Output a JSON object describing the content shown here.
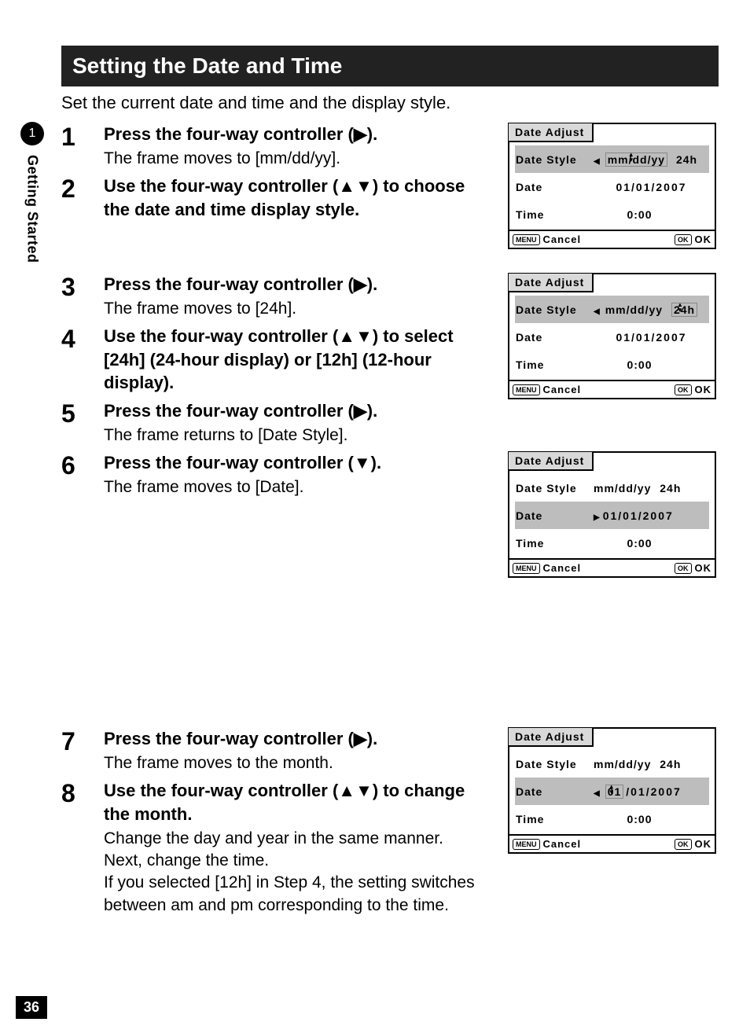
{
  "page_number": "36",
  "side_tab": {
    "chapter": "1",
    "label": "Getting Started"
  },
  "section_title": "Setting the Date and Time",
  "intro": "Set the current date and time and the display style.",
  "glyphs": {
    "right": "▶",
    "up": "▲",
    "down": "▼"
  },
  "steps": {
    "s1": {
      "num": "1",
      "instr_a": "Press the four-way controller (",
      "instr_b": ").",
      "desc": "The frame moves to [mm/dd/yy]."
    },
    "s2": {
      "num": "2",
      "instr_a": "Use the four-way controller (",
      "instr_b": ") to choose the date and time display style."
    },
    "s3": {
      "num": "3",
      "instr_a": "Press the four-way controller (",
      "instr_b": ").",
      "desc": "The frame moves to [24h]."
    },
    "s4": {
      "num": "4",
      "instr_a": "Use the four-way controller (",
      "instr_b": ") to select [24h] (24-hour display) or [12h] (12-hour display)."
    },
    "s5": {
      "num": "5",
      "instr_a": "Press the four-way controller (",
      "instr_b": ").",
      "desc": "The frame returns to [Date Style]."
    },
    "s6": {
      "num": "6",
      "instr_a": "Press the four-way controller (",
      "instr_b": ").",
      "desc": "The frame moves to [Date]."
    },
    "s7": {
      "num": "7",
      "instr_a": "Press the four-way controller (",
      "instr_b": ").",
      "desc": "The frame moves to the month."
    },
    "s8": {
      "num": "8",
      "instr_a": "Use the four-way controller (",
      "instr_b": ") to change the month.",
      "desc": "Change the day and year in the same manner.\nNext, change the time.\nIf you selected [12h] in Step 4, the setting switches between am and pm corresponding to the time."
    }
  },
  "lcd": {
    "title": "Date Adjust",
    "labels": {
      "style": "Date Style",
      "date": "Date",
      "time": "Time"
    },
    "values": {
      "style_fmt": "mm/dd/yy",
      "style_hr": "24h",
      "date": "01/01/2007",
      "month": "01",
      "rest": "/01/2007",
      "time": "0:00"
    },
    "footer": {
      "menu_btn": "MENU",
      "cancel": "Cancel",
      "ok_btn": "OK",
      "ok": "OK"
    }
  }
}
